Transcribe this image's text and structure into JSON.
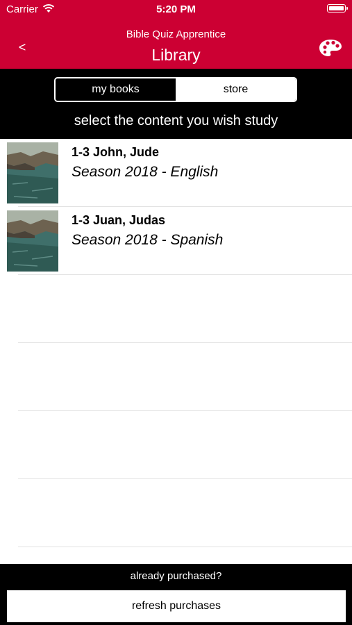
{
  "status_bar": {
    "carrier": "Carrier",
    "time": "5:20 PM"
  },
  "nav": {
    "back_label": "<",
    "subtitle": "Bible Quiz Apprentice",
    "title": "Library",
    "palette_icon": "palette-icon"
  },
  "segmented": {
    "my_books": "my books",
    "store": "store",
    "selected": "my books"
  },
  "instruction": "select the content you wish study",
  "books": [
    {
      "title": "1-3 John, Jude",
      "subtitle": "Season 2018 - English",
      "thumbnail": "lake-shore-photo"
    },
    {
      "title": "1-3 Juan, Judas",
      "subtitle": "Season 2018 - Spanish",
      "thumbnail": "lake-shore-photo"
    }
  ],
  "footer": {
    "purchased_label": "already purchased?",
    "refresh_label": "refresh purchases"
  },
  "colors": {
    "header_bg": "#cc0033",
    "band_bg": "#000000",
    "text_light": "#ffffff"
  }
}
